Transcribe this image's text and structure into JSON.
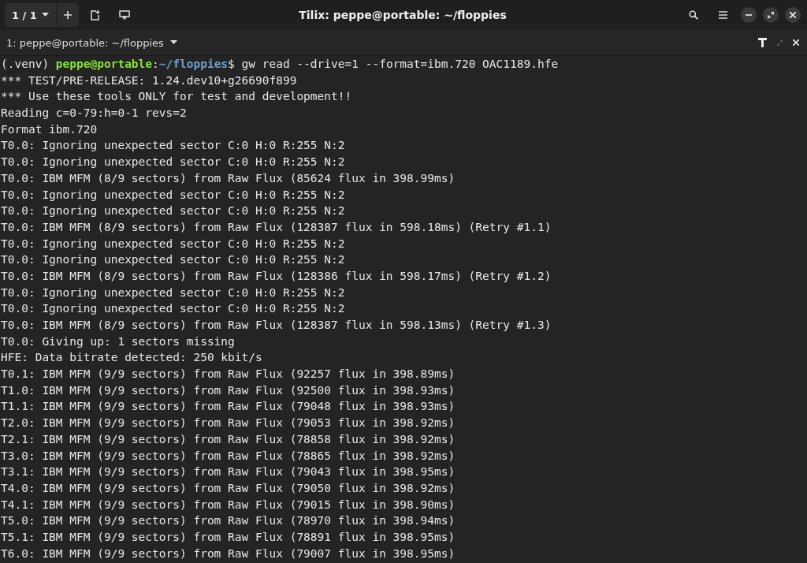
{
  "header": {
    "session_switcher": "1 / 1",
    "title": "Tilix: peppe@portable: ~/floppies"
  },
  "session_bar": {
    "title": "1: peppe@portable: ~/floppies"
  },
  "terminal": {
    "lines": [
      {
        "kind": "prompt",
        "venv": "(.venv) ",
        "user_host": "peppe@portable",
        "sep": ":",
        "cwd": "~/floppies",
        "command": "$ gw read --drive=1 --format=ibm.720 OAC1189.hfe"
      },
      {
        "kind": "output",
        "text": "*** TEST/PRE-RELEASE: 1.24.dev10+g26690f899"
      },
      {
        "kind": "output",
        "text": "*** Use these tools ONLY for test and development!!"
      },
      {
        "kind": "output",
        "text": "Reading c=0-79:h=0-1 revs=2"
      },
      {
        "kind": "output",
        "text": "Format ibm.720"
      },
      {
        "kind": "output",
        "text": "T0.0: Ignoring unexpected sector C:0 H:0 R:255 N:2"
      },
      {
        "kind": "output",
        "text": "T0.0: Ignoring unexpected sector C:0 H:0 R:255 N:2"
      },
      {
        "kind": "output",
        "text": "T0.0: IBM MFM (8/9 sectors) from Raw Flux (85624 flux in 398.99ms)"
      },
      {
        "kind": "output",
        "text": "T0.0: Ignoring unexpected sector C:0 H:0 R:255 N:2"
      },
      {
        "kind": "output",
        "text": "T0.0: Ignoring unexpected sector C:0 H:0 R:255 N:2"
      },
      {
        "kind": "output",
        "text": "T0.0: IBM MFM (8/9 sectors) from Raw Flux (128387 flux in 598.18ms) (Retry #1.1)"
      },
      {
        "kind": "output",
        "text": "T0.0: Ignoring unexpected sector C:0 H:0 R:255 N:2"
      },
      {
        "kind": "output",
        "text": "T0.0: Ignoring unexpected sector C:0 H:0 R:255 N:2"
      },
      {
        "kind": "output",
        "text": "T0.0: IBM MFM (8/9 sectors) from Raw Flux (128386 flux in 598.17ms) (Retry #1.2)"
      },
      {
        "kind": "output",
        "text": "T0.0: Ignoring unexpected sector C:0 H:0 R:255 N:2"
      },
      {
        "kind": "output",
        "text": "T0.0: Ignoring unexpected sector C:0 H:0 R:255 N:2"
      },
      {
        "kind": "output",
        "text": "T0.0: IBM MFM (8/9 sectors) from Raw Flux (128387 flux in 598.13ms) (Retry #1.3)"
      },
      {
        "kind": "output",
        "text": "T0.0: Giving up: 1 sectors missing"
      },
      {
        "kind": "output",
        "text": "HFE: Data bitrate detected: 250 kbit/s"
      },
      {
        "kind": "output",
        "text": "T0.1: IBM MFM (9/9 sectors) from Raw Flux (92257 flux in 398.89ms)"
      },
      {
        "kind": "output",
        "text": "T1.0: IBM MFM (9/9 sectors) from Raw Flux (92500 flux in 398.93ms)"
      },
      {
        "kind": "output",
        "text": "T1.1: IBM MFM (9/9 sectors) from Raw Flux (79048 flux in 398.93ms)"
      },
      {
        "kind": "output",
        "text": "T2.0: IBM MFM (9/9 sectors) from Raw Flux (79053 flux in 398.92ms)"
      },
      {
        "kind": "output",
        "text": "T2.1: IBM MFM (9/9 sectors) from Raw Flux (78858 flux in 398.92ms)"
      },
      {
        "kind": "output",
        "text": "T3.0: IBM MFM (9/9 sectors) from Raw Flux (78865 flux in 398.92ms)"
      },
      {
        "kind": "output",
        "text": "T3.1: IBM MFM (9/9 sectors) from Raw Flux (79043 flux in 398.95ms)"
      },
      {
        "kind": "output",
        "text": "T4.0: IBM MFM (9/9 sectors) from Raw Flux (79050 flux in 398.92ms)"
      },
      {
        "kind": "output",
        "text": "T4.1: IBM MFM (9/9 sectors) from Raw Flux (79015 flux in 398.90ms)"
      },
      {
        "kind": "output",
        "text": "T5.0: IBM MFM (9/9 sectors) from Raw Flux (78970 flux in 398.94ms)"
      },
      {
        "kind": "output",
        "text": "T5.1: IBM MFM (9/9 sectors) from Raw Flux (78891 flux in 398.95ms)"
      },
      {
        "kind": "output",
        "text": "T6.0: IBM MFM (9/9 sectors) from Raw Flux (79007 flux in 398.95ms)"
      }
    ]
  }
}
